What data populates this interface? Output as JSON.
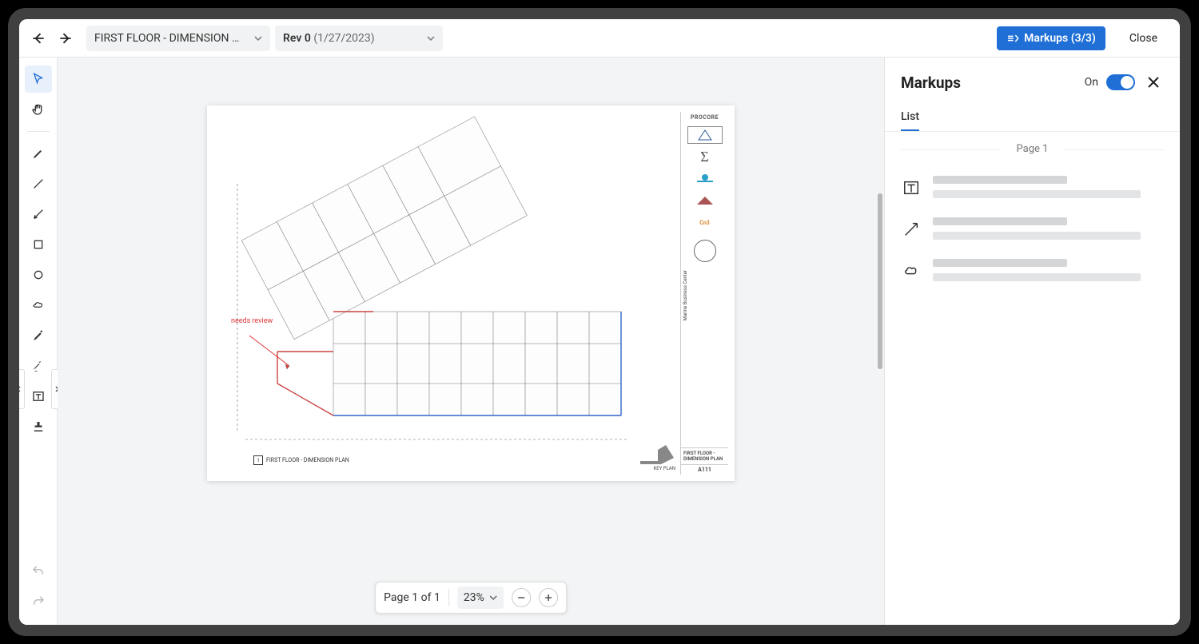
{
  "topbar": {
    "drawing_dropdown_label": "FIRST FLOOR - DIMENSION …",
    "revision_label": "Rev 0",
    "revision_date": "(1/27/2023)",
    "markups_button_label": "Markups (3/3)",
    "close_label": "Close"
  },
  "toolbar": {
    "tools": [
      "select",
      "pan",
      "pen",
      "line",
      "arrow",
      "rectangle",
      "ellipse",
      "cloud",
      "highlight",
      "text-highlight",
      "text-box",
      "stamp"
    ],
    "undo": "Undo",
    "redo": "Redo"
  },
  "drawing": {
    "annotation_text": "needs review",
    "caption_number": "1",
    "caption_text": "FIRST FLOOR - DIMENSION PLAN",
    "key_plan_label": "KEY PLAN",
    "titleblock": {
      "procore": "PROCORE",
      "cn3": "Cn3",
      "project_vert": "Marine Business Center",
      "sheet_title": "FIRST FLOOR - DIMENSION PLAN",
      "sheet_number": "A111"
    }
  },
  "page_controls": {
    "page_text": "Page 1 of 1",
    "zoom_text": "23%"
  },
  "panel": {
    "title": "Markups",
    "toggle_label": "On",
    "toggle_on": true,
    "tab_list": "List",
    "page_separator": "Page 1",
    "items": [
      {
        "type": "text-box"
      },
      {
        "type": "arrow"
      },
      {
        "type": "cloud"
      }
    ]
  }
}
